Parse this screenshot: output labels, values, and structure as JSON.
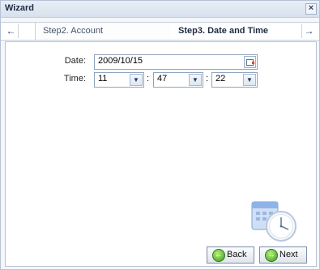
{
  "window": {
    "title": "Wizard",
    "close": "×"
  },
  "tabs": {
    "prev_arrow": "←",
    "next_arrow": "→",
    "inactive_label": "Step2. Account",
    "active_label": "Step3. Date and Time"
  },
  "form": {
    "date_label": "Date:",
    "date_value": "2009/10/15",
    "time_label": "Time:",
    "hour": "11",
    "minute": "47",
    "second": "22",
    "separator": ":"
  },
  "buttons": {
    "back": "Back",
    "next": "Next"
  },
  "icons": {
    "calendar": "calendar-icon",
    "clock_illustration": "calendar-clock-icon",
    "back": "back-arrow-icon",
    "next": "next-arrow-icon"
  }
}
